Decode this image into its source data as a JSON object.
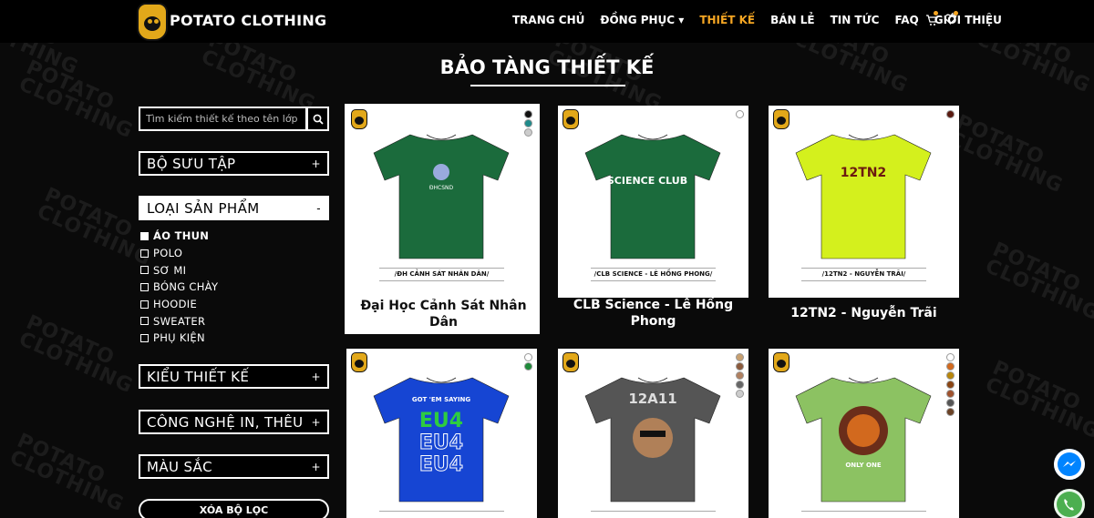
{
  "brand": {
    "name": "POTATO CLOTHING"
  },
  "nav": {
    "items": [
      "TRANG CHỦ",
      "ĐỒNG PHỤC ▾",
      "THIẾT KẾ",
      "BÁN LẺ",
      "TIN TỨC",
      "FAQ",
      "GIỚI THIỆU"
    ],
    "active_index": 2
  },
  "page": {
    "title": "BẢO TÀNG THIẾT KẾ"
  },
  "search": {
    "placeholder": "Tìm kiếm thiết kế theo tên lớp"
  },
  "filters": {
    "collection": "BỘ SƯU TẬP",
    "product_type": "LOẠI SẢN PHẨM",
    "design_type": "KIỂU THIẾT KẾ",
    "print_tech": "CÔNG NGHỆ IN, THÊU",
    "color": "MÀU SẮC",
    "plus": "+",
    "minus": "-",
    "clear": "XÓA BỘ LỌC"
  },
  "product_types": [
    {
      "label": "ÁO THUN",
      "checked": true
    },
    {
      "label": "POLO",
      "checked": false
    },
    {
      "label": "SƠ MI",
      "checked": false
    },
    {
      "label": "BÓNG CHÀY",
      "checked": false
    },
    {
      "label": "HOODIE",
      "checked": false
    },
    {
      "label": "SWEATER",
      "checked": false
    },
    {
      "label": "PHỤ KIỆN",
      "checked": false
    }
  ],
  "products": [
    {
      "name": "Đại Học Cảnh Sát Nhân Dân",
      "caption": "/ĐH CẢNH SÁT NHÂN DÂN/",
      "shirt_color": "#1b6b3c",
      "swatches": [
        "#111111",
        "#1f8a8a",
        "#cccccc"
      ]
    },
    {
      "name": "CLB Science - Lê Hồng Phong",
      "caption": "/CLB SCIENCE - LÊ HỒNG PHONG/",
      "shirt_color": "#1b6b3c",
      "swatches": [
        "#ffffff"
      ]
    },
    {
      "name": "12TN2 - Nguyễn Trãi",
      "caption": "/12TN2 - NGUYỄN TRÃI/",
      "shirt_color": "#d4f01d",
      "swatches": [
        "#5a1a10"
      ]
    },
    {
      "name": "",
      "caption": "",
      "shirt_color": "#1645d3",
      "swatches": [
        "#ffffff",
        "#1e8a3a"
      ]
    },
    {
      "name": "",
      "caption": "",
      "shirt_color": "#555555",
      "swatches": [
        "#c8a070",
        "#8b5a3c",
        "#b08060",
        "#666666",
        "#cccccc"
      ]
    },
    {
      "name": "",
      "caption": "",
      "shirt_color": "#8cc262",
      "swatches": [
        "#ffffff",
        "#d2691e",
        "#b8860b",
        "#8b4513",
        "#a0522d",
        "#555555",
        "#6b4226"
      ]
    }
  ],
  "shirt_graphics": {
    "p0": "ĐHCSND",
    "p1": "SCIENCE CLUB",
    "p2": "12TN2",
    "p3a": "GOT 'EM SAYING",
    "p3b": "EU4",
    "p4": "12A11",
    "p5": "ONLY ONE"
  }
}
